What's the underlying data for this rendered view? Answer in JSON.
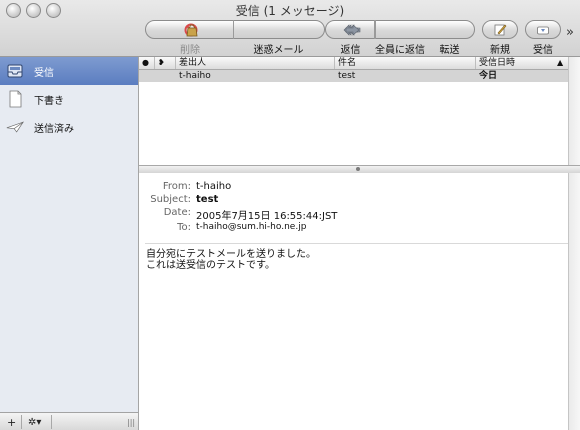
{
  "window": {
    "title": "受信 (1 メッセージ)"
  },
  "toolbar": {
    "delete_label": "削除",
    "junk_label": "迷惑メール",
    "reply_label": "返信",
    "reply_all_label": "全員に返信",
    "forward_label": "転送",
    "new_label": "新規",
    "get_label": "受信",
    "overflow": "»"
  },
  "sidebar": {
    "items": [
      {
        "label": "受信",
        "icon": "inbox-icon",
        "selected": true
      },
      {
        "label": "下書き",
        "icon": "drafts-icon",
        "selected": false
      },
      {
        "label": "送信済み",
        "icon": "sent-icon",
        "selected": false
      }
    ],
    "bottom": {
      "add": "+",
      "action": "✲▾",
      "resize": "|||"
    }
  },
  "list": {
    "columns": {
      "status": "●",
      "flag": "❥",
      "from": "差出人",
      "subject": "件名",
      "date": "受信日時"
    },
    "sort_indicator": "▲",
    "rows": [
      {
        "from": "t-haiho",
        "subject": "test",
        "date": "今日"
      }
    ]
  },
  "preview": {
    "from_key": "From:",
    "from_value": "t-haiho",
    "subject_key": "Subject:",
    "subject_value": "test",
    "date_key": "Date:",
    "date_value": "2005年7月15日 16:55:44:JST",
    "to_key": "To:",
    "to_value": "t-haiho@sum.hi-ho.ne.jp",
    "body_line1": "自分宛にテストメールを送りました。",
    "body_line2": "これは送受信のテストです。"
  },
  "colors": {
    "selection": "#5b7dc0",
    "sidebar_bg": "#e7ebf2",
    "row_highlight": "#d4d4d4"
  }
}
